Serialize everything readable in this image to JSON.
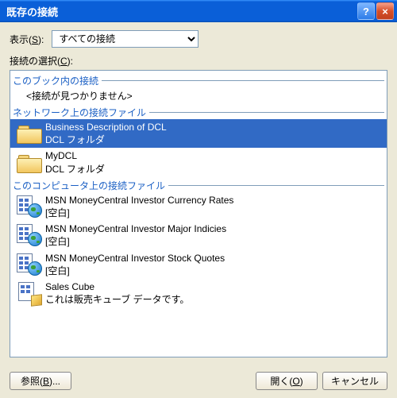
{
  "window": {
    "title": "既存の接続"
  },
  "show": {
    "label_pre": "表示(",
    "label_key": "S",
    "label_post": "):",
    "selected": "すべての接続"
  },
  "choose": {
    "label_pre": "接続の選択(",
    "label_key": "C",
    "label_post": "):"
  },
  "sections": {
    "workbook": {
      "header": "このブック内の接続",
      "empty": "<接続が見つかりません>"
    },
    "network": {
      "header": "ネットワーク上の接続ファイル",
      "items": [
        {
          "title": "Business Description of DCL",
          "sub": "DCL フォルダ",
          "selected": true,
          "icon": "folder"
        },
        {
          "title": "MyDCL",
          "sub": "DCL フォルダ",
          "selected": false,
          "icon": "folder"
        }
      ]
    },
    "computer": {
      "header": "このコンピュータ上の接続ファイル",
      "items": [
        {
          "title": "MSN MoneyCentral Investor Currency Rates",
          "sub": "[空白]",
          "icon": "odc"
        },
        {
          "title": "MSN MoneyCentral Investor Major Indicies",
          "sub": "[空白]",
          "icon": "odc"
        },
        {
          "title": "MSN MoneyCentral Investor Stock Quotes",
          "sub": "[空白]",
          "icon": "odc"
        },
        {
          "title": "Sales Cube",
          "sub": "これは販売キューブ データです。",
          "icon": "cube"
        }
      ]
    }
  },
  "buttons": {
    "browse_pre": "参照(",
    "browse_key": "B",
    "browse_post": ")...",
    "open_pre": "開く(",
    "open_key": "O",
    "open_post": ")",
    "cancel": "キャンセル"
  }
}
